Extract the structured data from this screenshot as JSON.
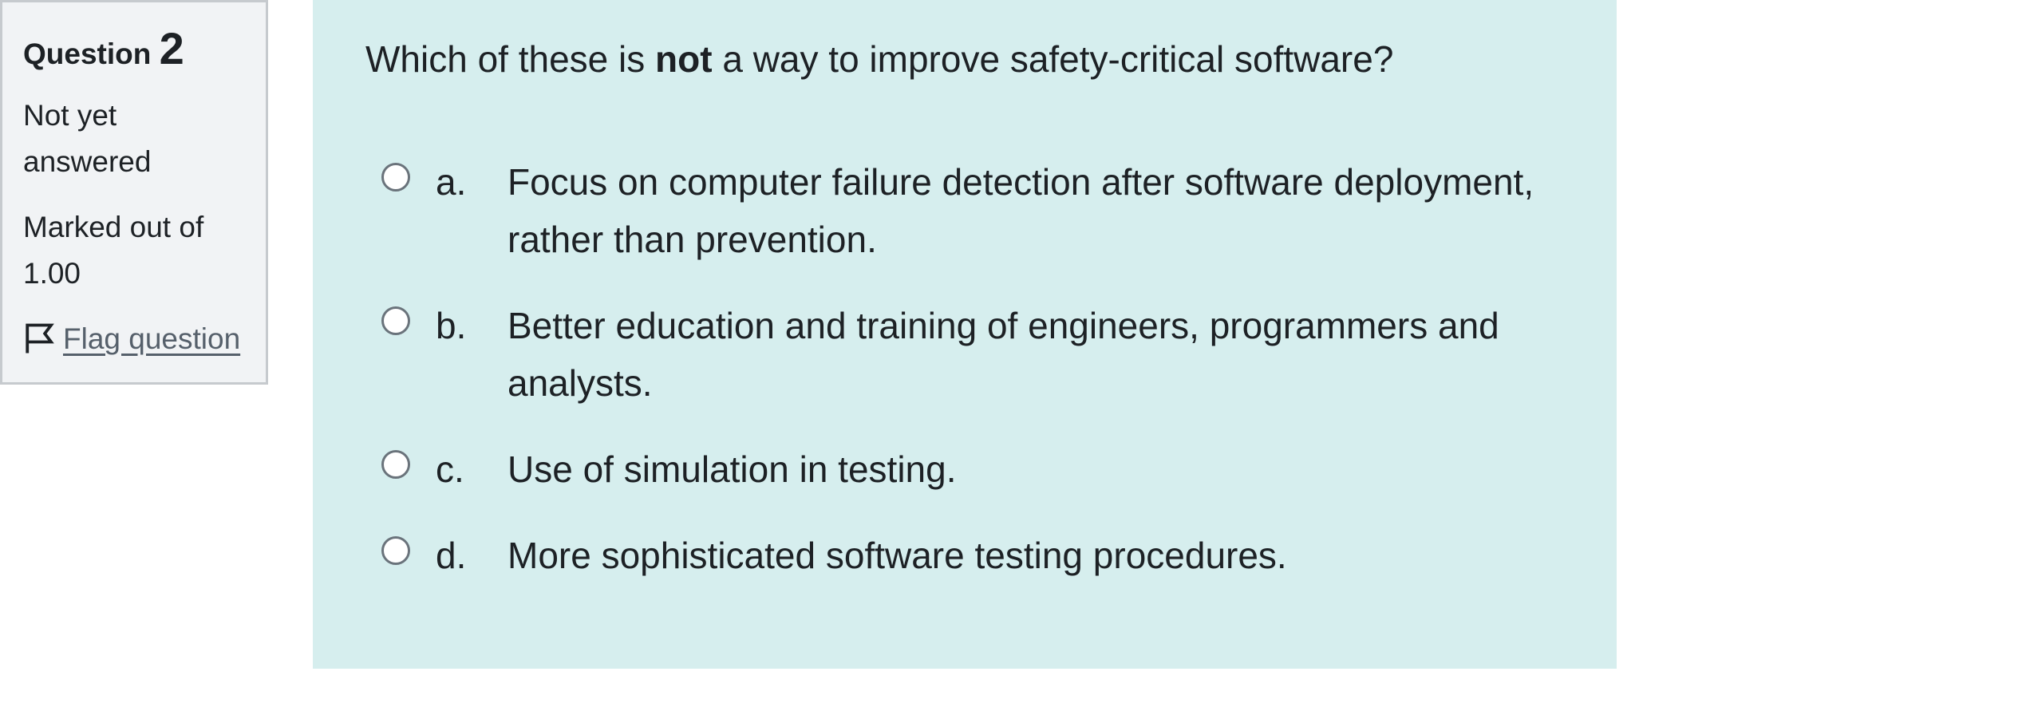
{
  "info": {
    "question_label": "Question",
    "question_number": "2",
    "state": "Not yet answered",
    "grade": "Marked out of 1.00",
    "flag_label": "Flag question"
  },
  "question": {
    "text_before": "Which of these is ",
    "text_bold": "not",
    "text_after": " a way to improve safety-critical software?",
    "answers": [
      {
        "letter": "a.",
        "text": "Focus on computer failure detection after software deployment, rather than prevention."
      },
      {
        "letter": "b.",
        "text": "Better education and training of engineers, programmers and analysts."
      },
      {
        "letter": "c.",
        "text": "Use of simulation in testing."
      },
      {
        "letter": "d.",
        "text": "More sophisticated software testing procedures."
      }
    ]
  },
  "icons": {
    "flag": "flag-icon"
  }
}
